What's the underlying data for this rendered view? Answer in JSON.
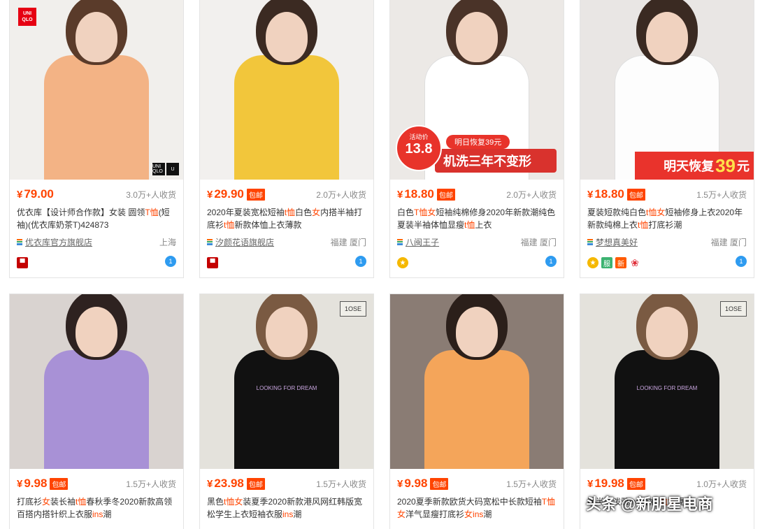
{
  "products": [
    {
      "price": "79.00",
      "yen": "¥",
      "baoyou": "",
      "sales": "3.0万+人收货",
      "title_parts": [
        [
          "优衣库【设计师合作款】女装 圆领",
          ""
        ],
        [
          "T恤",
          "hl"
        ],
        [
          "(短袖)(优衣库奶茶T)424873",
          ""
        ]
      ],
      "shop": "优衣库官方旗舰店",
      "location": "上海",
      "badges": [
        "tmall"
      ],
      "image_bg": "#f1efec",
      "shirt_color": "#f3b385",
      "hair_color": "#5a3b2a",
      "overlay": "uniqlo",
      "uniqlo_logo": "UNI QLO",
      "uniqlo_corner": [
        "UNI QLO",
        "U"
      ]
    },
    {
      "price": "29.90",
      "yen": "¥",
      "baoyou": "包邮",
      "sales": "2.0万+人收货",
      "title_parts": [
        [
          "2020年夏装宽松短袖",
          ""
        ],
        [
          "t恤",
          "hl"
        ],
        [
          "白色",
          ""
        ],
        [
          "女",
          "hl"
        ],
        [
          "内搭半袖打底衫",
          ""
        ],
        [
          "t恤",
          "hl"
        ],
        [
          "新款体恤上衣薄款",
          ""
        ]
      ],
      "shop": "汐颜花语旗舰店",
      "location": "福建 厦门",
      "badges": [
        "tmall"
      ],
      "image_bg": "#f2f0ee",
      "shirt_color": "#f2c63b",
      "hair_color": "#3b2a22",
      "overlay": ""
    },
    {
      "price": "18.80",
      "yen": "¥",
      "baoyou": "包邮",
      "sales": "2.0万+人收货",
      "title_parts": [
        [
          "白色",
          ""
        ],
        [
          "T恤",
          "hl"
        ],
        [
          "女",
          "hl"
        ],
        [
          "短袖纯棉修身2020年新款潮纯色夏装半袖体恤显瘦",
          ""
        ],
        [
          "t恤",
          "hl"
        ],
        [
          "上衣",
          ""
        ]
      ],
      "shop": "八闽王子",
      "location": "福建 厦门",
      "badges": [
        "gold"
      ],
      "image_bg": "#ece9e6",
      "shirt_color": "#ffffff",
      "hair_color": "#4a3328",
      "overlay": "promo1",
      "promo_label": "活动价",
      "promo_price": "13.8",
      "promo_top": "明日恢复39元",
      "promo_band": "机洗三年不变形"
    },
    {
      "price": "18.80",
      "yen": "¥",
      "baoyou": "包邮",
      "sales": "1.5万+人收货",
      "title_parts": [
        [
          "夏装短款纯白色",
          ""
        ],
        [
          "t恤",
          "hl"
        ],
        [
          "女",
          "hl"
        ],
        [
          "短袖修身上衣2020年新款纯棉上衣",
          ""
        ],
        [
          "t恤",
          "hl"
        ],
        [
          "打底衫潮",
          ""
        ]
      ],
      "shop": "梦想真美好",
      "location": "福建 厦门",
      "badges": [
        "gold",
        "green",
        "orange",
        "flower"
      ],
      "image_bg": "#e9e6e4",
      "shirt_color": "#fdfdfd",
      "hair_color": "#3a2a22",
      "overlay": "promo2",
      "promo_text": "明天恢复",
      "promo_num": "39",
      "promo_unit": "元",
      "badge_text": {
        "green": "服",
        "orange": "新"
      }
    },
    {
      "price": "9.98",
      "yen": "¥",
      "baoyou": "包邮",
      "sales": "1.5万+人收货",
      "title_parts": [
        [
          "打底衫",
          ""
        ],
        [
          "女",
          "hl"
        ],
        [
          "装长袖",
          ""
        ],
        [
          "t恤",
          "hl"
        ],
        [
          "春秋季冬2020新款高领百搭内搭针织上衣服",
          ""
        ],
        [
          "ins",
          "hl"
        ],
        [
          "潮",
          ""
        ]
      ],
      "image_bg": "#d9d3d0",
      "shirt_color": "#a891d6",
      "hair_color": "#2e2220",
      "overlay": ""
    },
    {
      "price": "23.98",
      "yen": "¥",
      "baoyou": "包邮",
      "sales": "1.5万+人收货",
      "title_parts": [
        [
          "黑色",
          ""
        ],
        [
          "t恤",
          "hl"
        ],
        [
          "女",
          "hl"
        ],
        [
          "装夏季2020新款港风网红韩版宽松学生上衣短袖衣服",
          ""
        ],
        [
          "ins",
          "hl"
        ],
        [
          "潮",
          ""
        ]
      ],
      "image_bg": "#e4e2dc",
      "shirt_color": "#111111",
      "hair_color": "#7a5a42",
      "overlay": "sign",
      "sign_text": "1OSE",
      "shirt_text": "LOOKING FOR DREAM"
    },
    {
      "price": "9.98",
      "yen": "¥",
      "baoyou": "包邮",
      "sales": "1.5万+人收货",
      "title_parts": [
        [
          "2020夏季新款欧货大码宽松中长款短袖",
          ""
        ],
        [
          "T恤",
          "hl"
        ],
        [
          "女",
          "hl"
        ],
        [
          "洋气显瘦打底衫",
          ""
        ],
        [
          "女",
          "hl"
        ],
        [
          "ins",
          "hl"
        ],
        [
          "潮",
          ""
        ]
      ],
      "image_bg": "#8a7c74",
      "shirt_color": "#f4a55a",
      "hair_color": "#2b1f1a",
      "overlay": ""
    },
    {
      "price": "19.98",
      "yen": "¥",
      "baoyou": "包邮",
      "sales": "1.0万+人收货",
      "title_parts": [
        [
          "版半气泼雅ins短袖",
          ""
        ],
        [
          "t恤",
          "hl"
        ],
        [
          "女",
          "hl"
        ],
        [
          "夏",
          ""
        ]
      ],
      "image_bg": "#e4e2dc",
      "shirt_color": "#111111",
      "hair_color": "#7a5a42",
      "overlay": "sign",
      "sign_text": "1OSE",
      "shirt_text": "LOOKING FOR DREAM"
    }
  ],
  "watermark": "头条 @新朋星电商",
  "wangwang_glyph": "1"
}
